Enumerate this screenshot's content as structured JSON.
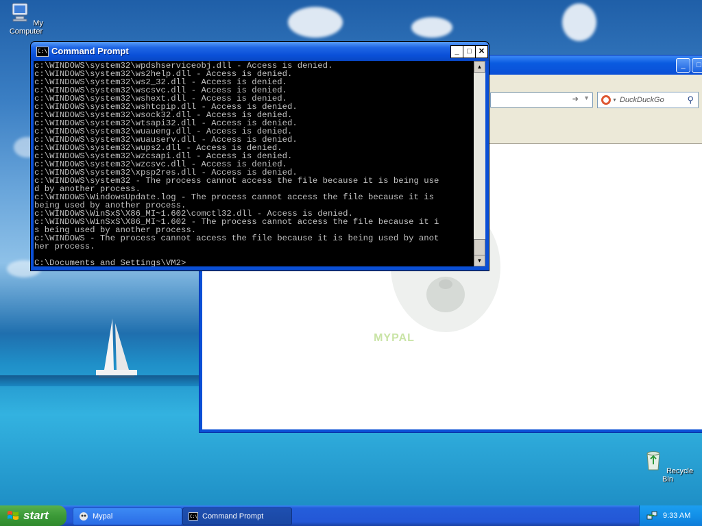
{
  "desktop": {
    "icons": {
      "my_computer": "My Computer",
      "recycle_bin": "Recycle Bin"
    }
  },
  "browser": {
    "search_placeholder": "DuckDuckGo",
    "mascot_caption": "MYPAL"
  },
  "cmd": {
    "title": "Command Prompt",
    "icon_text": "C:\\",
    "lines": [
      "c:\\WINDOWS\\system32\\wpdshserviceobj.dll - Access is denied.",
      "c:\\WINDOWS\\system32\\ws2help.dll - Access is denied.",
      "c:\\WINDOWS\\system32\\ws2_32.dll - Access is denied.",
      "c:\\WINDOWS\\system32\\wscsvc.dll - Access is denied.",
      "c:\\WINDOWS\\system32\\wshext.dll - Access is denied.",
      "c:\\WINDOWS\\system32\\wshtcpip.dll - Access is denied.",
      "c:\\WINDOWS\\system32\\wsock32.dll - Access is denied.",
      "c:\\WINDOWS\\system32\\wtsapi32.dll - Access is denied.",
      "c:\\WINDOWS\\system32\\wuaueng.dll - Access is denied.",
      "c:\\WINDOWS\\system32\\wuauserv.dll - Access is denied.",
      "c:\\WINDOWS\\system32\\wups2.dll - Access is denied.",
      "c:\\WINDOWS\\system32\\wzcsapi.dll - Access is denied.",
      "c:\\WINDOWS\\system32\\wzcsvc.dll - Access is denied.",
      "c:\\WINDOWS\\system32\\xpsp2res.dll - Access is denied.",
      "c:\\WINDOWS\\system32 - The process cannot access the file because it is being use",
      "d by another process.",
      "c:\\WINDOWS\\WindowsUpdate.log - The process cannot access the file because it is",
      "being used by another process.",
      "c:\\WINDOWS\\WinSxS\\X86_MI~1.602\\comctl32.dll - Access is denied.",
      "c:\\WINDOWS\\WinSxS\\X86_MI~1.602 - The process cannot access the file because it i",
      "s being used by another process.",
      "c:\\WINDOWS - The process cannot access the file because it is being used by anot",
      "her process.",
      "",
      "C:\\Documents and Settings\\VM2>"
    ],
    "buttons": {
      "minimize": "_",
      "maximize": "□",
      "close": "✕"
    }
  },
  "taskbar": {
    "start_label": "start",
    "tasks": [
      {
        "label": "Mypal"
      },
      {
        "label": "Command Prompt"
      }
    ],
    "clock": "9:33 AM"
  }
}
